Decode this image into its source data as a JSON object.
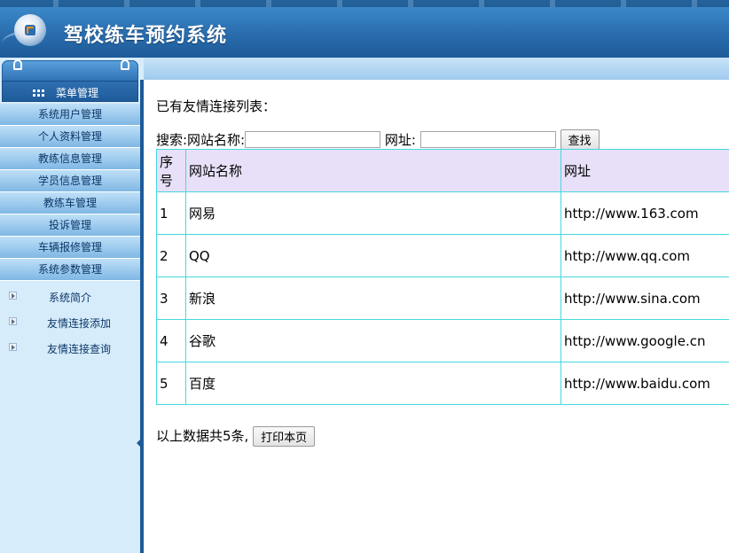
{
  "app": {
    "title": "驾校练车预约系统"
  },
  "menu": {
    "title": "菜单管理",
    "items": [
      "系统用户管理",
      "个人资料管理",
      "教练信息管理",
      "学员信息管理",
      "教练车管理",
      "投诉管理",
      "车辆报修管理",
      "系统参数管理"
    ],
    "subitems": [
      "系统简介",
      "友情连接添加",
      "友情连接查询"
    ]
  },
  "main": {
    "heading": "已有友情连接列表：",
    "search": {
      "label": "搜索:网站名称:",
      "url_label": "网址:",
      "name_value": "",
      "url_value": "",
      "button": "查找"
    },
    "table": {
      "headers": [
        "序号",
        "网站名称",
        "网址"
      ],
      "rows": [
        [
          "1",
          "网易",
          "http://www.163.com"
        ],
        [
          "2",
          "QQ",
          "http://www.qq.com"
        ],
        [
          "3",
          "新浪",
          "http://www.sina.com"
        ],
        [
          "4",
          "谷歌",
          "http://www.google.cn"
        ],
        [
          "5",
          "百度",
          "http://www.baidu.com"
        ]
      ]
    },
    "footer_text": "以上数据共5条,",
    "print_button": "打印本页"
  },
  "colors": {
    "header": "#2b6fb0",
    "sidebar": "#d7ecfb",
    "table_border": "#44d8e0",
    "table_header": "#e8e0f8"
  }
}
